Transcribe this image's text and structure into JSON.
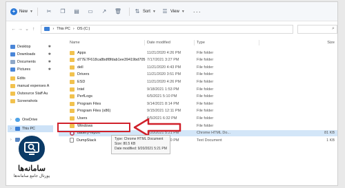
{
  "toolbar": {
    "new_label": "New",
    "sort_label": "Sort",
    "view_label": "View"
  },
  "address": {
    "crumbs": [
      "This PC",
      "OS (C:)"
    ]
  },
  "nav": {
    "items": [
      {
        "label": "Desktop",
        "icon": "blue",
        "pinned": true
      },
      {
        "label": "Downloads",
        "icon": "blue",
        "pinned": true
      },
      {
        "label": "Documents",
        "icon": "doc",
        "pinned": true
      },
      {
        "label": "Pictures",
        "icon": "blue",
        "pinned": true
      },
      {
        "label": "Edits",
        "icon": "folder",
        "pinned": false
      },
      {
        "label": "manual expenses A",
        "icon": "folder",
        "pinned": false
      },
      {
        "label": "Outsource Staff Au",
        "icon": "folder",
        "pinned": false
      },
      {
        "label": "Screenshots",
        "icon": "folder",
        "pinned": false
      },
      {
        "label": "OneDrive",
        "icon": "cloud",
        "pinned": false
      },
      {
        "label": "This PC",
        "icon": "pc",
        "pinned": false
      },
      {
        "label": "Network",
        "icon": "net",
        "pinned": false
      }
    ]
  },
  "columns": {
    "name": "Name",
    "date": "Date modified",
    "type": "Type",
    "size": "Size"
  },
  "files": [
    {
      "name": "Apps",
      "date": "11/21/2020 4:26 PM",
      "type": "File folder",
      "size": "",
      "kind": "folder"
    },
    {
      "name": "d77E7F618ca8bdf8fdab1ee39419bd705",
      "date": "7/17/2021 3:27 PM",
      "type": "File folder",
      "size": "",
      "kind": "folder"
    },
    {
      "name": "dell",
      "date": "11/21/2020 4:43 PM",
      "type": "File folder",
      "size": "",
      "kind": "folder"
    },
    {
      "name": "Drivers",
      "date": "11/21/2020 3:51 PM",
      "type": "File folder",
      "size": "",
      "kind": "folder"
    },
    {
      "name": "ESD",
      "date": "11/21/2020 4:26 PM",
      "type": "File folder",
      "size": "",
      "kind": "folder"
    },
    {
      "name": "Intel",
      "date": "9/18/2021 1:53 PM",
      "type": "File folder",
      "size": "",
      "kind": "folder"
    },
    {
      "name": "PerfLogs",
      "date": "6/5/2021 5:10 PM",
      "type": "File folder",
      "size": "",
      "kind": "folder"
    },
    {
      "name": "Program Files",
      "date": "9/14/2021 8:14 PM",
      "type": "File folder",
      "size": "",
      "kind": "folder"
    },
    {
      "name": "Program Files (x86)",
      "date": "9/15/2021 12:11 PM",
      "type": "File folder",
      "size": "",
      "kind": "folder"
    },
    {
      "name": "Users",
      "date": "6/5/2021 6:32 PM",
      "type": "File folder",
      "size": "",
      "kind": "folder"
    },
    {
      "name": "Windows",
      "date": "9/15/2021 8:44 PM",
      "type": "File folder",
      "size": "",
      "kind": "folder"
    },
    {
      "name": "battery-report",
      "date": "9/20/2021 5:21 PM",
      "type": "Chrome HTML Do...",
      "size": "81 KB",
      "kind": "chrome"
    },
    {
      "name": "DumpStack",
      "date": "9/20/2021 5:20 PM",
      "type": "Text Document",
      "size": "1 KB",
      "kind": "txt"
    }
  ],
  "tooltip": {
    "line1": "Type: Chrome HTML Document",
    "line2": "Size: 80.5 KB",
    "line3": "Date modified: 9/20/2021 5:21 PM"
  },
  "logo": {
    "title": "سامانه‌ها",
    "subtitle": "پورتال جامع سامانه‌ها"
  },
  "colors": {
    "highlight": "#d0202a",
    "selection": "#cde2f7",
    "folder": "#f2c24e",
    "logo_bg": "#0b3a66"
  }
}
